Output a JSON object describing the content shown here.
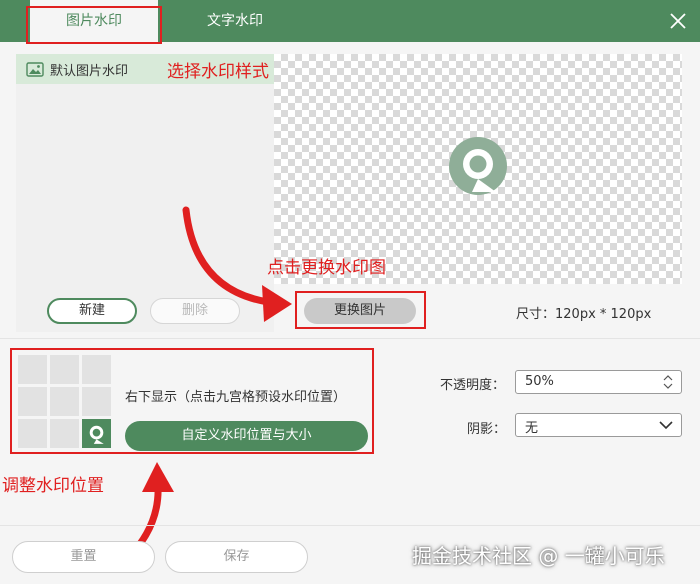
{
  "tabs": {
    "image": "图片水印",
    "text": "文字水印"
  },
  "colors": {
    "accent": "#4e8a5e",
    "annotation": "#e02020"
  },
  "list": {
    "items": [
      {
        "label": "默认图片水印",
        "icon": "image-icon"
      }
    ]
  },
  "buttons": {
    "new": "新建",
    "delete": "删除",
    "change_image": "更换图片",
    "custom_position": "自定义水印位置与大小",
    "reset": "重置",
    "save": "保存"
  },
  "size_label": "尺寸：120px * 120px",
  "position": {
    "text": "右下显示（点击九宫格预设水印位置）",
    "selected_cell": 8
  },
  "opacity": {
    "label": "不透明度：",
    "value": "50%"
  },
  "shadow": {
    "label": "阴影：",
    "value": "无"
  },
  "annotations": {
    "select_style": "选择水印样式",
    "change_image": "点击更换水印图",
    "adjust_position": "调整水印位置"
  },
  "corner_watermark": "掘金技术社区 @ 一罐小可乐"
}
